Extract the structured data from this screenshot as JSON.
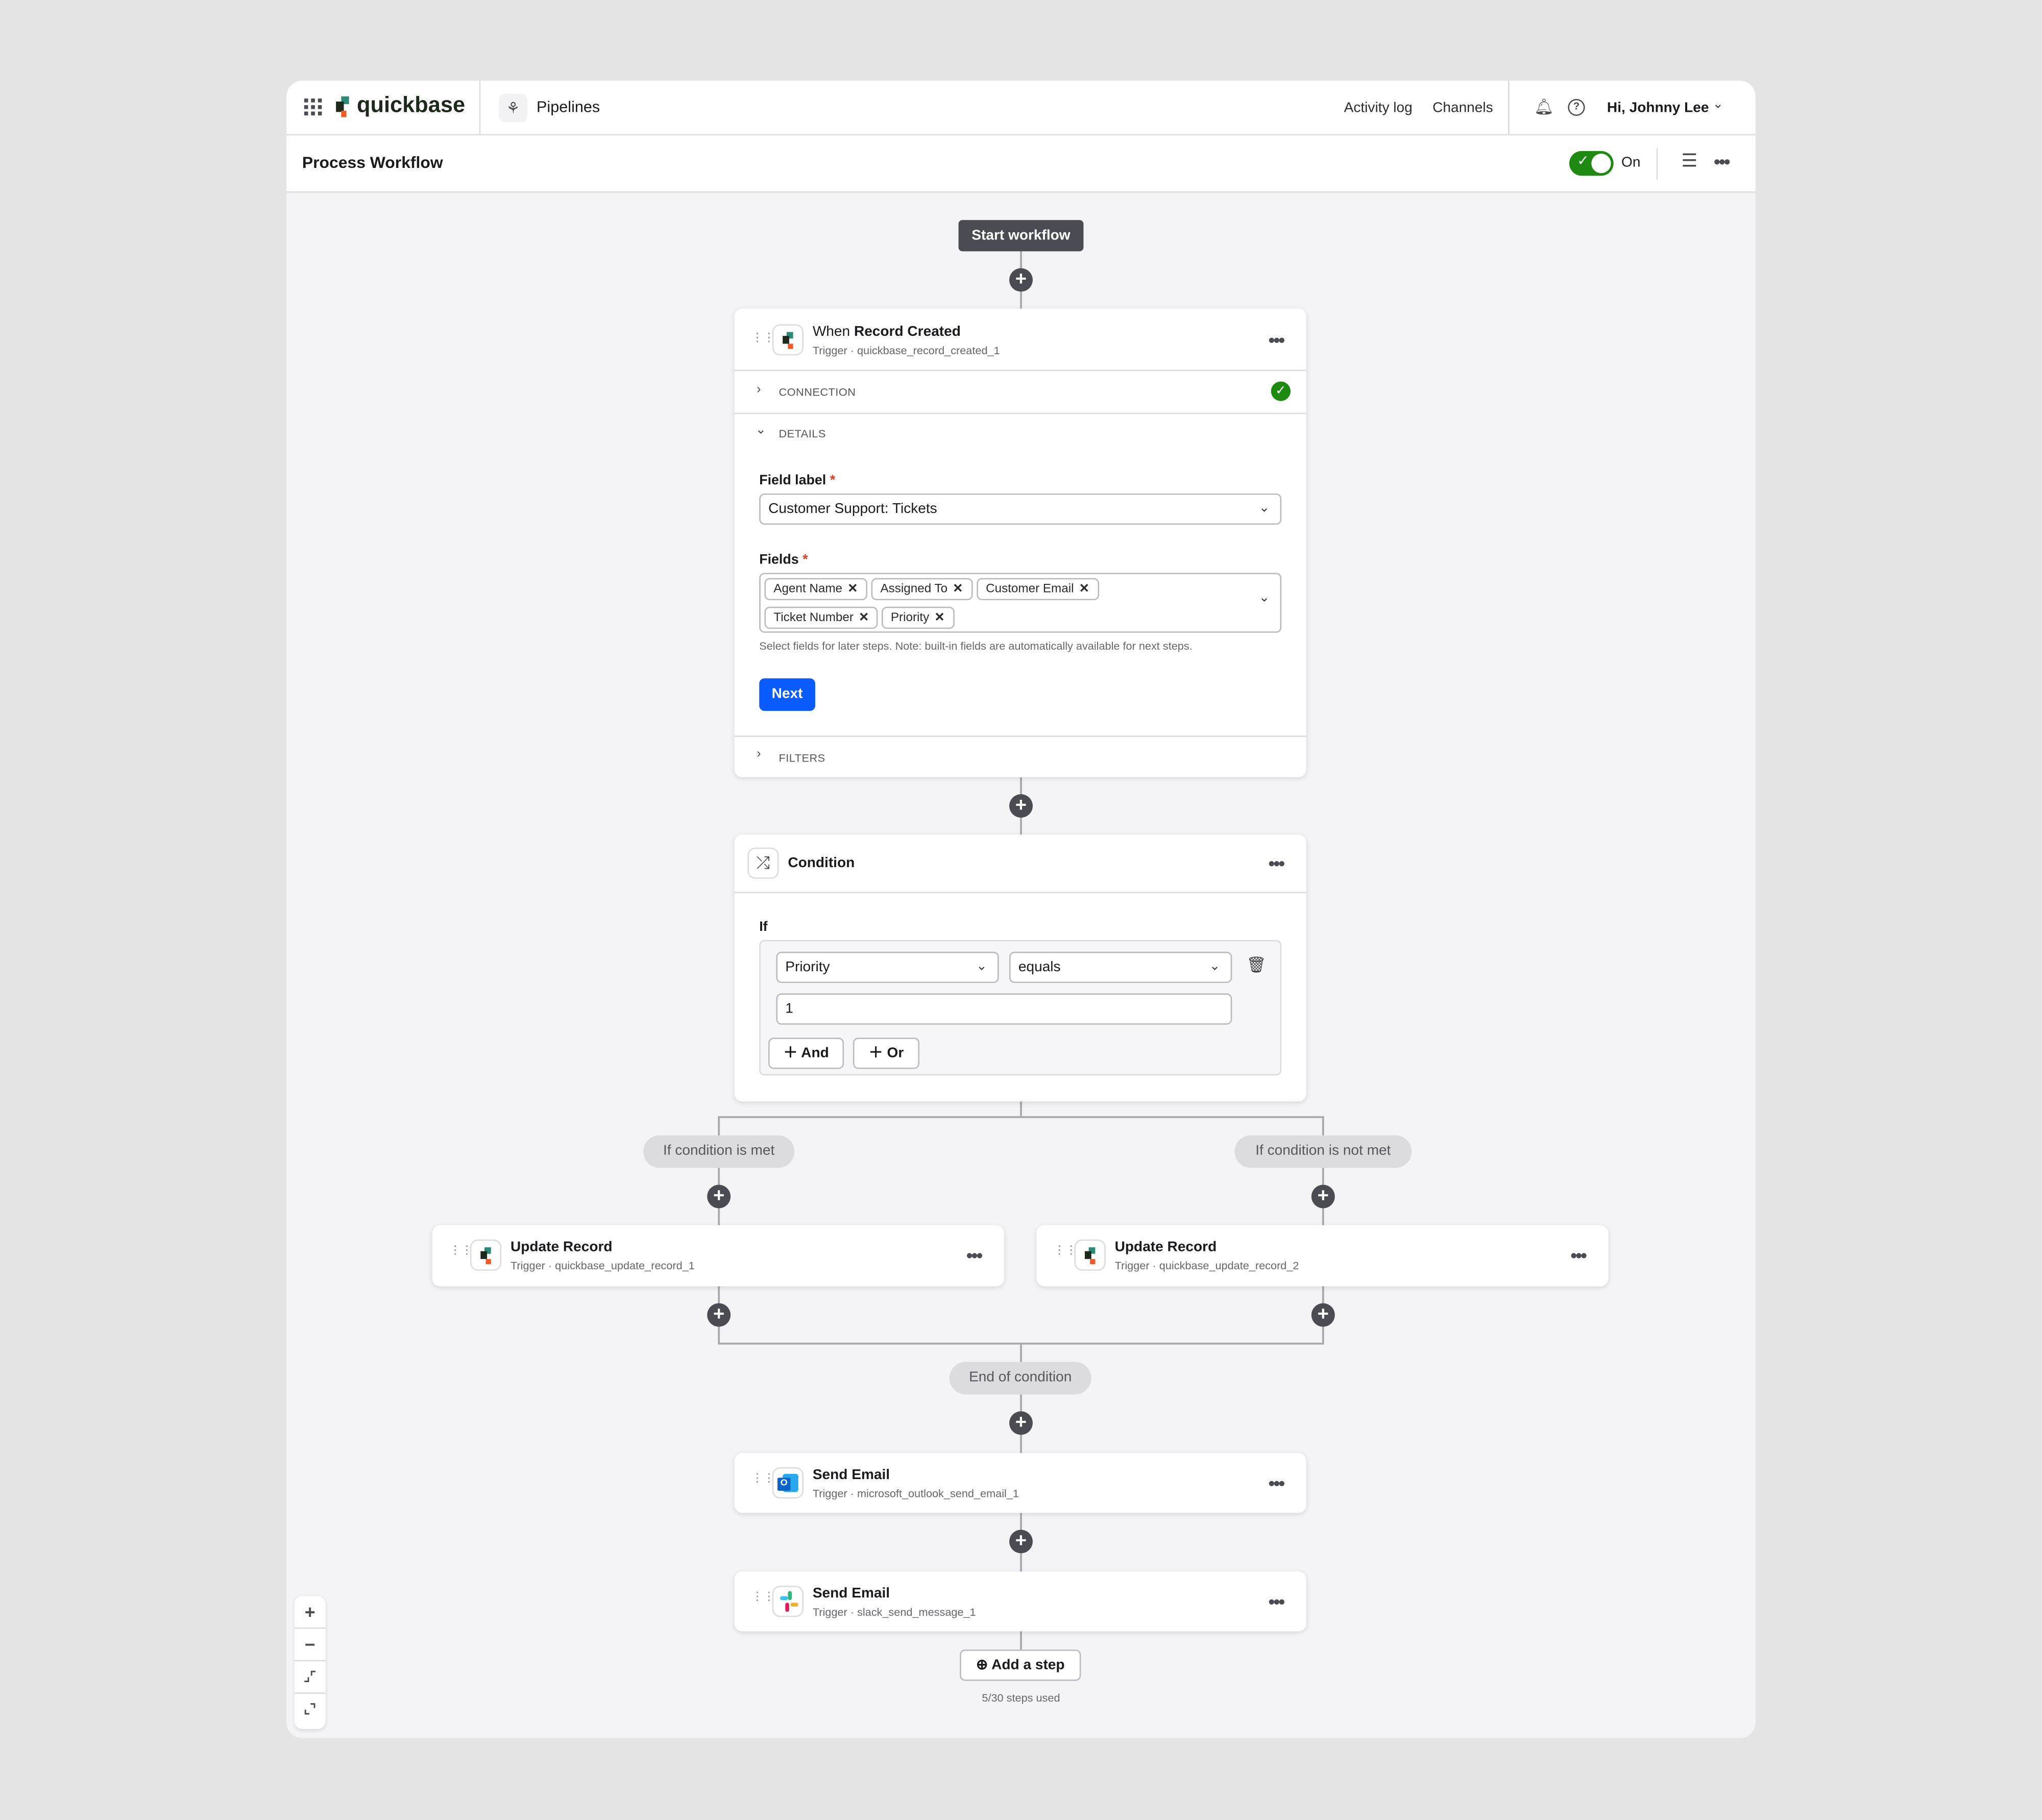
{
  "nav": {
    "brand": "quickbase",
    "section": "Pipelines",
    "links": [
      "Activity log",
      "Channels"
    ],
    "user": "Hi, Johnny Lee"
  },
  "subheader": {
    "title": "Process Workflow",
    "toggle_label": "On",
    "toggle_on": true
  },
  "canvas": {
    "start_label": "Start workflow",
    "trigger": {
      "title_prefix": "When ",
      "title_bold": "Record Created",
      "subtitle": "Trigger · quickbase_record_created_1",
      "connection": "CONNECTION",
      "details": "DETAILS",
      "filters": "FILTERS",
      "field_label": "Field label",
      "field_value": "Customer Support: Tickets",
      "fields_label": "Fields",
      "chips": [
        "Agent Name",
        "Assigned To",
        "Customer Email",
        "Ticket Number",
        "Priority"
      ],
      "helper": "Select fields for later steps. Note: built-in fields are automatically available for next steps.",
      "next": "Next"
    },
    "condition": {
      "title": "Condition",
      "if": "If",
      "field": "Priority",
      "operator": "equals",
      "value": "1",
      "and": "And",
      "or": "Or"
    },
    "branch_met": "If condition is met",
    "branch_not_met": "If condition is not met",
    "update1": {
      "title": "Update Record",
      "subtitle": "Trigger · quickbase_update_record_1"
    },
    "update2": {
      "title": "Update Record",
      "subtitle": "Trigger · quickbase_update_record_2"
    },
    "end_label": "End of condition",
    "email1": {
      "title": "Send Email",
      "subtitle": "Trigger · microsoft_outlook_send_email_1"
    },
    "email2": {
      "title": "Send Email",
      "subtitle": "Trigger · slack_send_message_1"
    },
    "add_step": "Add a step",
    "steps_used": "5/30 steps used"
  },
  "colors": {
    "accent": "#0a5cff",
    "toggle": "#1f8a12",
    "success": "#1f8a12",
    "dark": "#4b4b53"
  }
}
